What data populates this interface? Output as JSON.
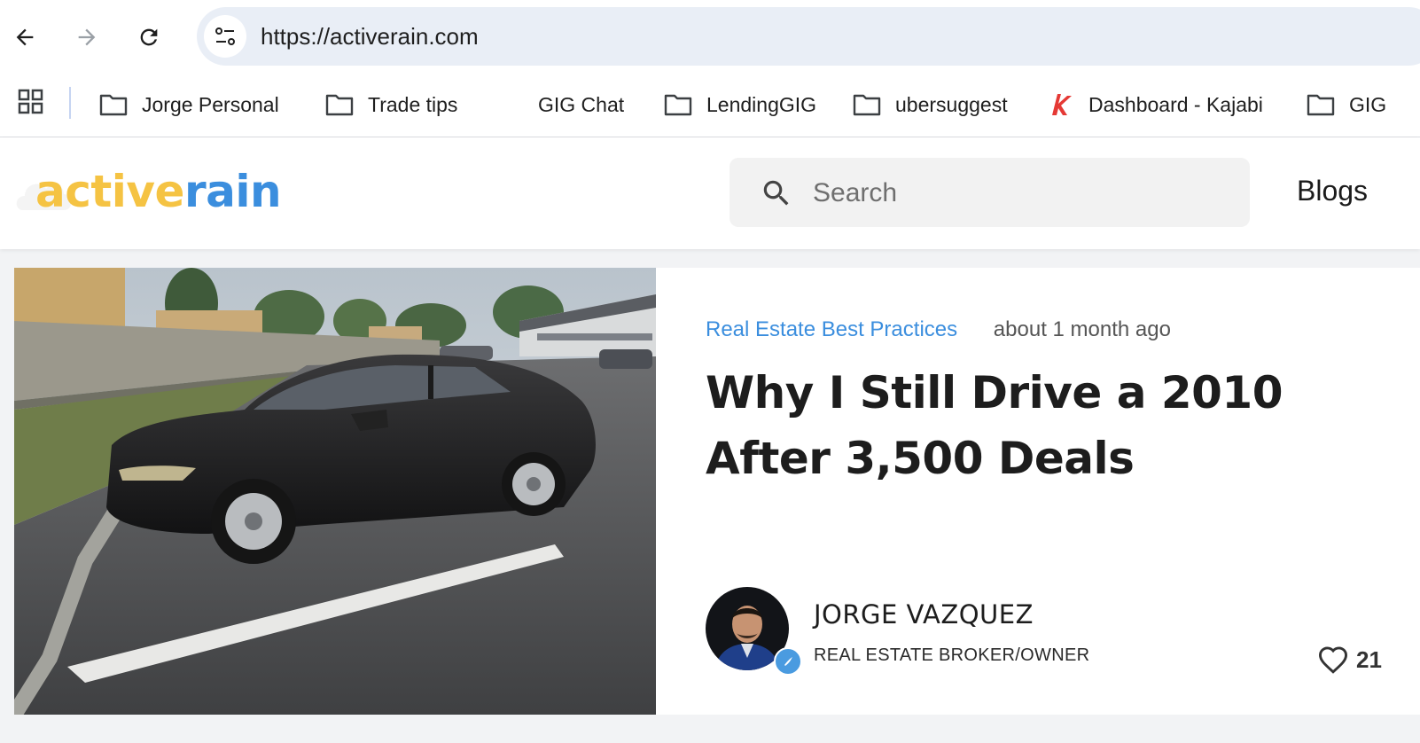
{
  "browser": {
    "url": "https://activerain.com",
    "bookmarks": [
      {
        "label": "Jorge Personal",
        "icon": "folder-icon"
      },
      {
        "label": "Trade tips",
        "icon": "folder-icon"
      },
      {
        "label": "GIG Chat",
        "icon": "none"
      },
      {
        "label": "LendingGIG",
        "icon": "folder-icon"
      },
      {
        "label": "ubersuggest",
        "icon": "folder-icon"
      },
      {
        "label": "Dashboard - Kajabi",
        "icon": "kajabi-icon"
      },
      {
        "label": "GIG",
        "icon": "folder-icon"
      }
    ]
  },
  "site": {
    "logo_part1": "active",
    "logo_part2": "rain",
    "search_placeholder": "Search",
    "nav_blogs": "Blogs",
    "colors": {
      "logo_yellow": "#f5c343",
      "logo_blue": "#3b8ede",
      "category_blue": "#3b8ede"
    }
  },
  "post": {
    "category": "Real Estate Best Practices",
    "time_ago": "about 1 month ago",
    "title": "Why I Still Drive a 2010 After 3,500 Deals",
    "author_name": "JORGE VAZQUEZ",
    "author_role": "REAL ESTATE BROKER/OWNER",
    "likes": "21"
  }
}
